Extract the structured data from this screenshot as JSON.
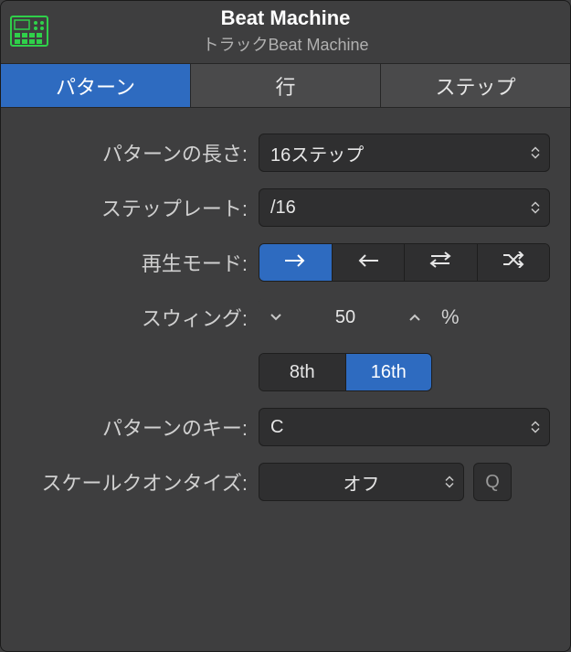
{
  "header": {
    "title": "Beat Machine",
    "subtitle": "トラックBeat Machine"
  },
  "tabs": [
    {
      "label": "パターン",
      "active": true
    },
    {
      "label": "行",
      "active": false
    },
    {
      "label": "ステップ",
      "active": false
    }
  ],
  "labels": {
    "patternLength": "パターンの長さ:",
    "stepRate": "ステップレート:",
    "playMode": "再生モード:",
    "swing": "スウィング:",
    "patternKey": "パターンのキー:",
    "scaleQuantize": "スケールクオンタイズ:"
  },
  "values": {
    "patternLength": "16ステップ",
    "stepRate": "/16",
    "swingValue": "50",
    "swingUnit": "%",
    "swingResolution": {
      "eighth": "8th",
      "sixteenth": "16th",
      "active": "16th"
    },
    "patternKey": "C",
    "scaleQuantize": "オフ",
    "quantizeButton": "Q"
  },
  "playModes": [
    {
      "name": "forward",
      "active": true
    },
    {
      "name": "reverse",
      "active": false
    },
    {
      "name": "pingpong",
      "active": false
    },
    {
      "name": "random",
      "active": false
    }
  ]
}
